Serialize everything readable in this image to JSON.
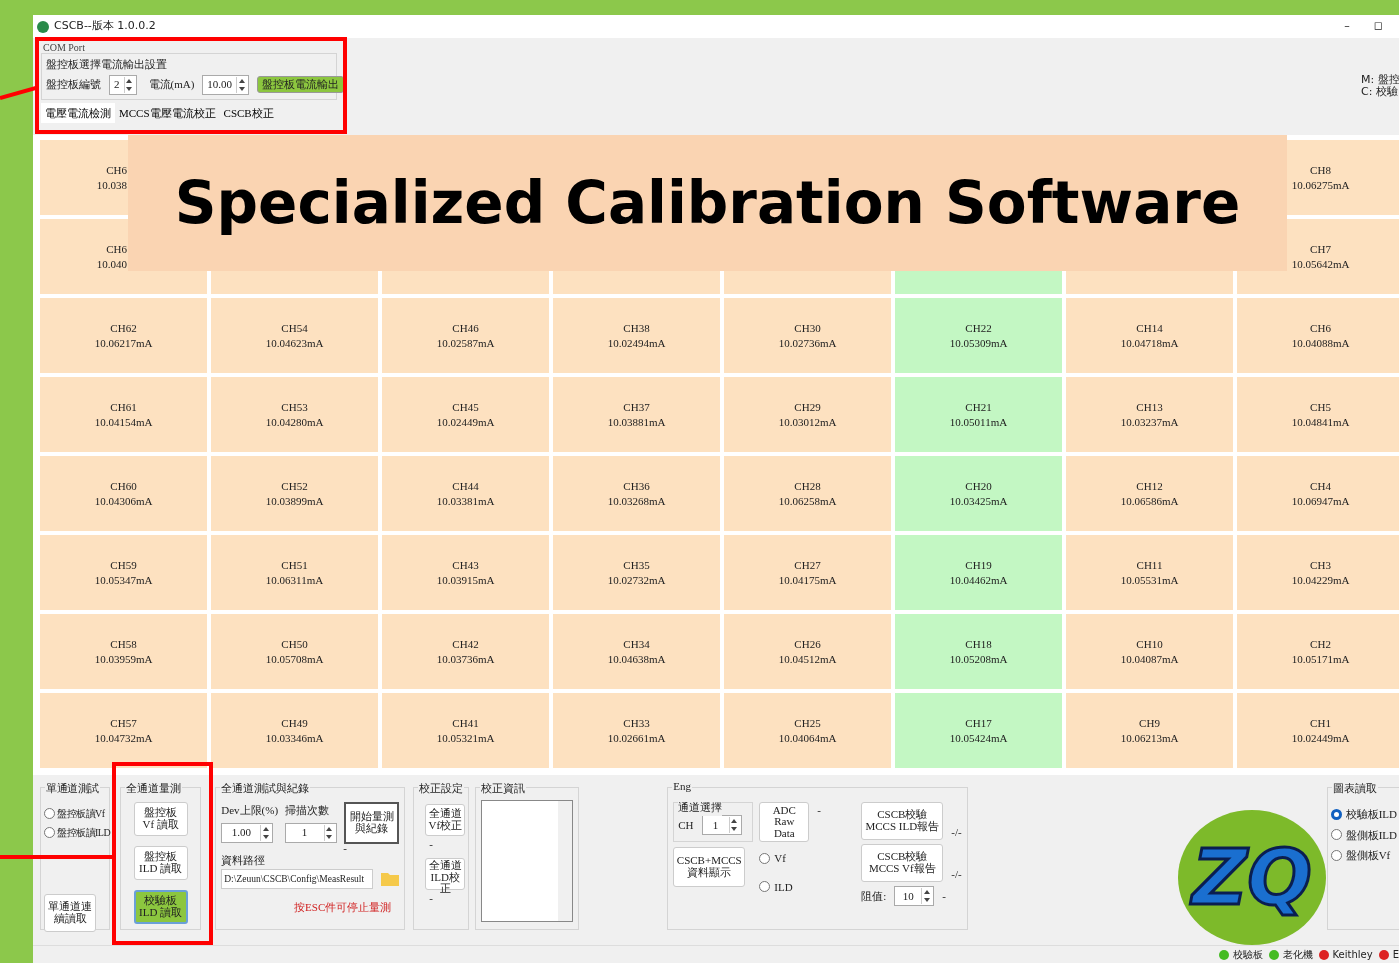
{
  "window": {
    "title": "CSCB--版本 1.0.0.2",
    "controls": [
      "–",
      "◻"
    ]
  },
  "top": {
    "com_port": "COM Port",
    "group_title": "盤控板選擇電流輸出設置",
    "board_label": "盤控板編號",
    "board_value": "2",
    "current_label": "電流(mA)",
    "current_value": "10.00",
    "output_button": "盤控板電流輸出",
    "tabs": [
      {
        "label": "電壓電流檢測",
        "selected": true
      },
      {
        "label": "MCCS電壓電流校正",
        "selected": false
      },
      {
        "label": "CSCB校正",
        "selected": false
      }
    ],
    "legend": [
      "M: 盤控",
      "C: 校驗"
    ]
  },
  "banner": "Specialized Calibration Software",
  "grid": [
    [
      {
        "label": "CH6",
        "value": "10.038",
        "highlighted": false
      },
      {
        "label": "CH8",
        "value": "10.06275mA",
        "highlighted": false
      }
    ],
    [
      {
        "label": "CH6",
        "value": "10.040",
        "highlighted": false
      },
      {
        "highlighted": false
      },
      {
        "highlighted": false
      },
      {
        "highlighted": false
      },
      {
        "highlighted": false
      },
      {
        "highlighted": true
      },
      {
        "highlighted": false
      },
      {
        "label": "CH7",
        "value": "10.05642mA",
        "highlighted": false
      }
    ],
    [
      {
        "label": "CH62",
        "value": "10.06217mA",
        "highlighted": false
      },
      {
        "label": "CH54",
        "value": "10.04623mA",
        "highlighted": false
      },
      {
        "label": "CH46",
        "value": "10.02587mA",
        "highlighted": false
      },
      {
        "label": "CH38",
        "value": "10.02494mA",
        "highlighted": false
      },
      {
        "label": "CH30",
        "value": "10.02736mA",
        "highlighted": false
      },
      {
        "label": "CH22",
        "value": "10.05309mA",
        "highlighted": true
      },
      {
        "label": "CH14",
        "value": "10.04718mA",
        "highlighted": false
      },
      {
        "label": "CH6",
        "value": "10.04088mA",
        "highlighted": false
      }
    ],
    [
      {
        "label": "CH61",
        "value": "10.04154mA",
        "highlighted": false
      },
      {
        "label": "CH53",
        "value": "10.04280mA",
        "highlighted": false
      },
      {
        "label": "CH45",
        "value": "10.02449mA",
        "highlighted": false
      },
      {
        "label": "CH37",
        "value": "10.03881mA",
        "highlighted": false
      },
      {
        "label": "CH29",
        "value": "10.03012mA",
        "highlighted": false
      },
      {
        "label": "CH21",
        "value": "10.05011mA",
        "highlighted": true
      },
      {
        "label": "CH13",
        "value": "10.03237mA",
        "highlighted": false
      },
      {
        "label": "CH5",
        "value": "10.04841mA",
        "highlighted": false
      }
    ],
    [
      {
        "label": "CH60",
        "value": "10.04306mA",
        "highlighted": false
      },
      {
        "label": "CH52",
        "value": "10.03899mA",
        "highlighted": false
      },
      {
        "label": "CH44",
        "value": "10.03381mA",
        "highlighted": false
      },
      {
        "label": "CH36",
        "value": "10.03268mA",
        "highlighted": false
      },
      {
        "label": "CH28",
        "value": "10.06258mA",
        "highlighted": false
      },
      {
        "label": "CH20",
        "value": "10.03425mA",
        "highlighted": true
      },
      {
        "label": "CH12",
        "value": "10.06586mA",
        "highlighted": false
      },
      {
        "label": "CH4",
        "value": "10.06947mA",
        "highlighted": false
      }
    ],
    [
      {
        "label": "CH59",
        "value": "10.05347mA",
        "highlighted": false
      },
      {
        "label": "CH51",
        "value": "10.06311mA",
        "highlighted": false
      },
      {
        "label": "CH43",
        "value": "10.03915mA",
        "highlighted": false
      },
      {
        "label": "CH35",
        "value": "10.02732mA",
        "highlighted": false
      },
      {
        "label": "CH27",
        "value": "10.04175mA",
        "highlighted": false
      },
      {
        "label": "CH19",
        "value": "10.04462mA",
        "highlighted": true
      },
      {
        "label": "CH11",
        "value": "10.05531mA",
        "highlighted": false
      },
      {
        "label": "CH3",
        "value": "10.04229mA",
        "highlighted": false
      }
    ],
    [
      {
        "label": "CH58",
        "value": "10.03959mA",
        "highlighted": false
      },
      {
        "label": "CH50",
        "value": "10.05708mA",
        "highlighted": false
      },
      {
        "label": "CH42",
        "value": "10.03736mA",
        "highlighted": false
      },
      {
        "label": "CH34",
        "value": "10.04638mA",
        "highlighted": false
      },
      {
        "label": "CH26",
        "value": "10.04512mA",
        "highlighted": false
      },
      {
        "label": "CH18",
        "value": "10.05208mA",
        "highlighted": true
      },
      {
        "label": "CH10",
        "value": "10.04087mA",
        "highlighted": false
      },
      {
        "label": "CH2",
        "value": "10.05171mA",
        "highlighted": false
      }
    ],
    [
      {
        "label": "CH57",
        "value": "10.04732mA",
        "highlighted": false
      },
      {
        "label": "CH49",
        "value": "10.03346mA",
        "highlighted": false
      },
      {
        "label": "CH41",
        "value": "10.05321mA",
        "highlighted": false
      },
      {
        "label": "CH33",
        "value": "10.02661mA",
        "highlighted": false
      },
      {
        "label": "CH25",
        "value": "10.04064mA",
        "highlighted": false
      },
      {
        "label": "CH17",
        "value": "10.05424mA",
        "highlighted": true
      },
      {
        "label": "CH9",
        "value": "10.06213mA",
        "highlighted": false
      },
      {
        "label": "CH1",
        "value": "10.02449mA",
        "highlighted": false
      }
    ]
  ],
  "single": {
    "title": "單通道測試",
    "radios": [
      {
        "label": "盤控板讀Vf",
        "selected": false
      },
      {
        "label": "盤控板讀ILD",
        "selected": false
      }
    ],
    "button": "單通道連續讀取"
  },
  "all_measure": {
    "title": "全通道量測",
    "buttons": [
      {
        "label": "盤控板\nVf 讀取",
        "highlighted": false
      },
      {
        "label": "盤控板\nILD 讀取",
        "highlighted": false
      },
      {
        "label": "校驗板\nILD 讀取",
        "highlighted": true
      }
    ]
  },
  "record": {
    "title": "全通道測試與紀錄",
    "dev_label": "Dev上限(%)",
    "dev_value": "1.00",
    "scan_label": "掃描次數",
    "scan_value": "1",
    "start_button": "開始量測與紀錄",
    "dot": "-",
    "path_label": "資料路徑",
    "path_value": "D:\\Zeuun\\CSCB\\Config\\MeasResult",
    "hint": "按ESC件可停止量測"
  },
  "calib": {
    "title": "校正設定",
    "buttons": [
      {
        "label": "全通道\nVf校正",
        "note": "-"
      },
      {
        "label": "全通道\nILD校正",
        "note": "-"
      }
    ]
  },
  "calib_info": {
    "title": "校正資訊"
  },
  "eng": {
    "title": "Eng",
    "ch_group": "通道選擇",
    "ch_label": "CH",
    "ch_value": "1",
    "adc_button": "ADC Raw\nData",
    "adc_note": "-",
    "display_button": "CSCB+MCCS\n資料顯示",
    "radios": [
      {
        "label": "Vf",
        "selected": false
      },
      {
        "label": "ILD",
        "selected": false
      }
    ],
    "reports": [
      {
        "label": "CSCB校驗\nMCCS ILD報告",
        "note": "-/-"
      },
      {
        "label": "CSCB校驗\nMCCS Vf報告",
        "note": "-/-"
      }
    ],
    "res_label": "阻值:",
    "res_value": "10",
    "res_note": "-"
  },
  "logo": "ZQ",
  "chart_read": {
    "title": "圖表讀取",
    "radios": [
      {
        "label": "校驗板ILD",
        "selected": true
      },
      {
        "label": "盤側板ILD",
        "selected": false
      },
      {
        "label": "盤側板Vf",
        "selected": false
      }
    ]
  },
  "status": [
    {
      "label": "校驗板",
      "color": "#44bb22"
    },
    {
      "label": "老化機",
      "color": "#44bb22"
    },
    {
      "label": "Keithley",
      "color": "#dd2222"
    },
    {
      "label": "E",
      "color": "#dd2222"
    }
  ]
}
